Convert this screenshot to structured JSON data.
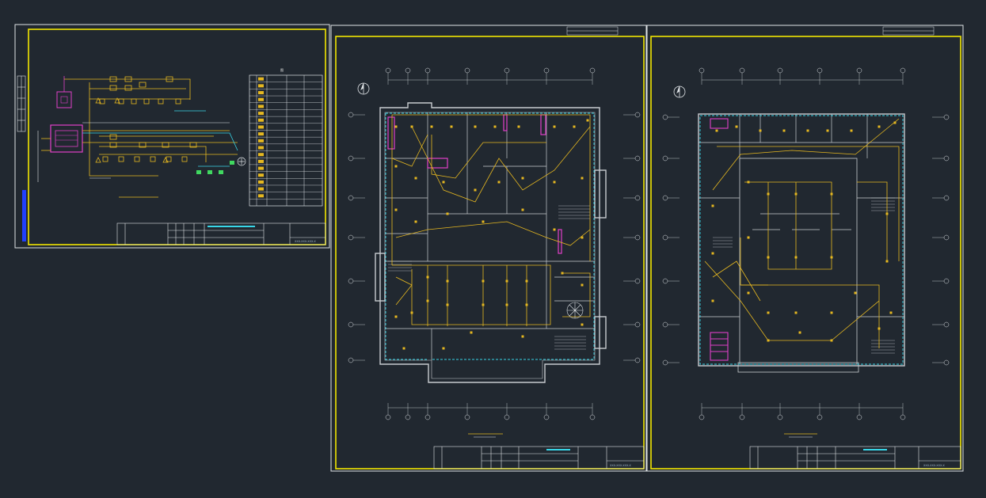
{
  "colors": {
    "background": "#212830",
    "frame_white": "#dfe3e6",
    "border_yellow": "#f2e600",
    "wiring_yellow": "#e6b820",
    "wall_gray": "#c8ccd0",
    "cyan": "#38d6e8",
    "magenta": "#e040c8",
    "green": "#40d860",
    "blue": "#2040ff",
    "red": "#e03030"
  },
  "sheets": [
    {
      "id": "system-diagram",
      "kind": "schematic",
      "north_arrow": false,
      "note": "",
      "title_block_code": "XXX-XXX-XXX-X"
    },
    {
      "id": "floor-plan-1",
      "kind": "floor-plan",
      "north_arrow": true,
      "note": "",
      "title_block_code": "XXX-XXX-XXX-X"
    },
    {
      "id": "floor-plan-2",
      "kind": "floor-plan",
      "north_arrow": true,
      "note": "",
      "title_block_code": "XXX-XXX-XXX-X"
    }
  ],
  "legend": {
    "title": "图",
    "rows": 18
  },
  "icons": {
    "north_arrow": "north-arrow-icon",
    "fire_controller": "fire-controller-icon",
    "fan": "fan-icon"
  }
}
